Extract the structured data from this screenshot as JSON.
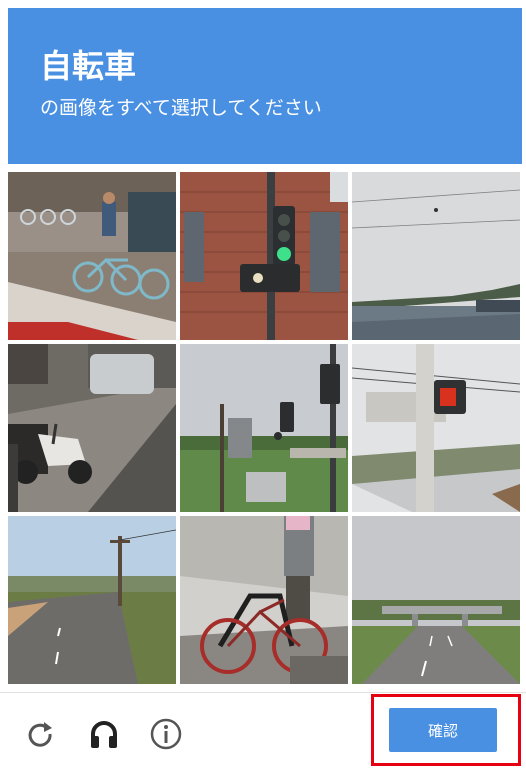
{
  "header": {
    "title": "自転車",
    "instruction": "の画像をすべて選択してください"
  },
  "grid": {
    "tiles": [
      "bike-share-dock",
      "traffic-light-brick-building",
      "lake-view",
      "parked-scooter",
      "traffic-light-field",
      "pedestrian-signal-pole",
      "highway-road",
      "person-with-bicycle",
      "highway-overpass"
    ]
  },
  "footer": {
    "icons": [
      "reload-icon",
      "audio-icon",
      "info-icon"
    ],
    "verify_label": "確認"
  },
  "colors": {
    "accent": "#4a90e2",
    "highlight_border": "#e60012"
  }
}
